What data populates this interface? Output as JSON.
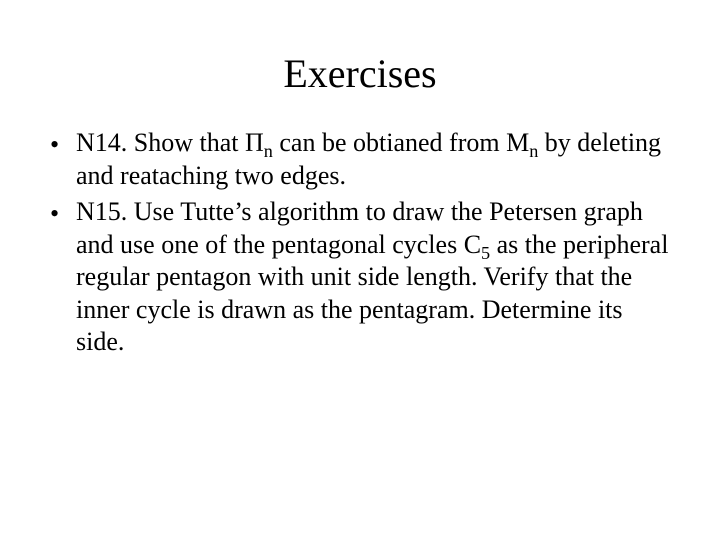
{
  "title": "Exercises",
  "bullets": [
    {
      "prefix": "N14.",
      "pre1": " Show that  ",
      "sym1": "Π",
      "sub1": "n",
      "mid1": " can be obtianed from ",
      "sym2": "M",
      "sub2": "n",
      "post1": " by deleting and reataching two edges."
    },
    {
      "prefix": "N15.",
      "pre1": " Use Tutte’s algorithm to draw the Petersen graph and use one of the pentagonal cycles C",
      "sub1": "5",
      "post1": " as the peripheral regular pentagon with unit side length. Verify that the inner cycle is drawn as the pentagram.  Determine its side."
    }
  ]
}
